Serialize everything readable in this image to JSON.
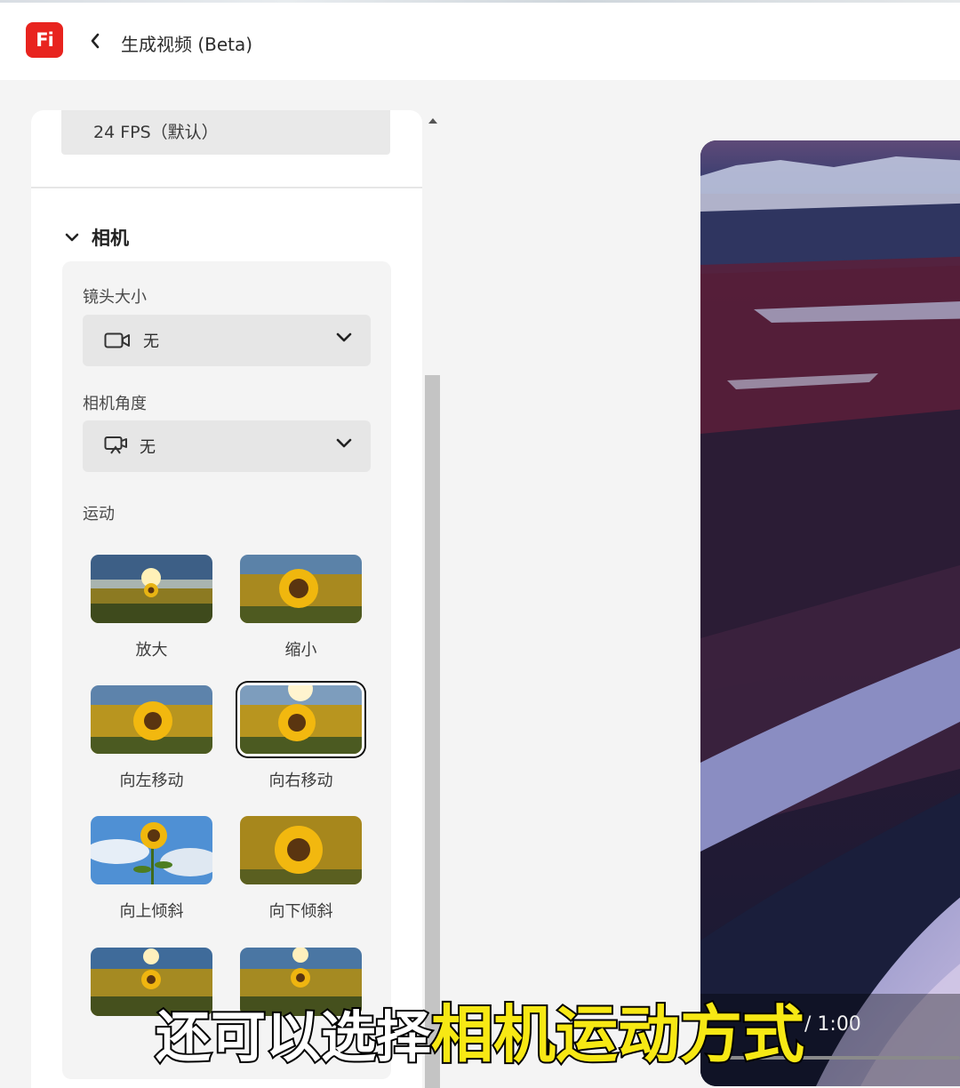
{
  "header": {
    "logo_text": "Fi",
    "title": "生成视频 (Beta)"
  },
  "settings": {
    "frame_rate_value": "24 FPS（默认）",
    "camera_section_title": "相机",
    "shot_size": {
      "label": "镜头大小",
      "value": "无"
    },
    "camera_angle": {
      "label": "相机角度",
      "value": "无"
    },
    "motion_label": "运动",
    "motion_options": [
      {
        "label": "放大",
        "selected": false
      },
      {
        "label": "缩小",
        "selected": false
      },
      {
        "label": "向左移动",
        "selected": false
      },
      {
        "label": "向右移动",
        "selected": true
      },
      {
        "label": "向上倾斜",
        "selected": false
      },
      {
        "label": "向下倾斜",
        "selected": false
      },
      {
        "label": "",
        "selected": false
      },
      {
        "label": "",
        "selected": false
      }
    ]
  },
  "preview": {
    "time_display": "/ 1:00"
  },
  "caption": {
    "part1": "还可以选择",
    "part2": "相机运动方式"
  },
  "colors": {
    "brand_red": "#e8231e",
    "caption_yellow": "#f7e814"
  }
}
